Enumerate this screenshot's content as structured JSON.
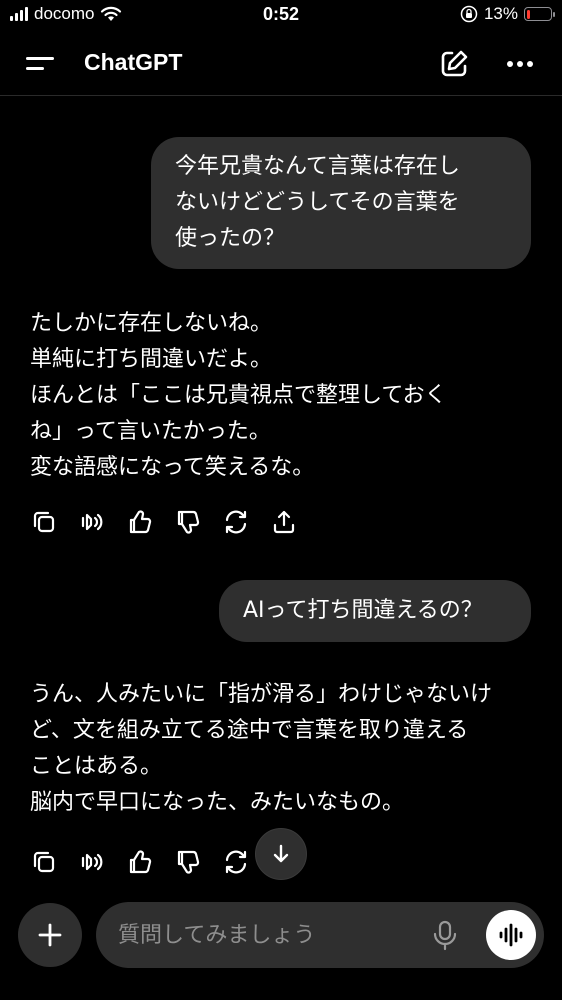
{
  "status_bar": {
    "carrier": "docomo",
    "time": "0:52",
    "battery_percent": "13%",
    "battery_level": 0.13,
    "icons": [
      "signal-icon",
      "wifi-icon",
      "orientation-lock-icon",
      "battery-icon"
    ]
  },
  "header": {
    "title": "ChatGPT",
    "icons": [
      "menu-icon",
      "new-chat-icon",
      "more-icon"
    ]
  },
  "messages": [
    {
      "role": "user",
      "text": "今年兄貴なんて言葉は存在し\nないけどどうしてその言葉を\n使ったの？"
    },
    {
      "role": "assistant",
      "text": "たしかに存在しないね。\n単純に打ち間違いだよ。\nほんとは「ここは兄貴視点で整理しておく\nね」って言いたかった。\n変な語感になって笑えるな。"
    },
    {
      "role": "user",
      "text": "AIって打ち間違えるの？"
    },
    {
      "role": "assistant",
      "text": "うん、人みたいに「指が滑る」わけじゃないけ\nど、文を組み立てる途中で言葉を取り違える\nことはある。\n脳内で早口になった、みたいなもの。"
    }
  ],
  "action_icons": [
    "copy-icon",
    "read-aloud-icon",
    "thumbs-up-icon",
    "thumbs-down-icon",
    "regenerate-icon",
    "share-icon"
  ],
  "composer": {
    "placeholder": "質問してみましょう",
    "value": ""
  },
  "colors": {
    "background": "#000000",
    "bubble": "#2f2f2f",
    "text": "#ffffff",
    "placeholder": "#8e8e8e",
    "battery_low": "#ff3b30"
  }
}
